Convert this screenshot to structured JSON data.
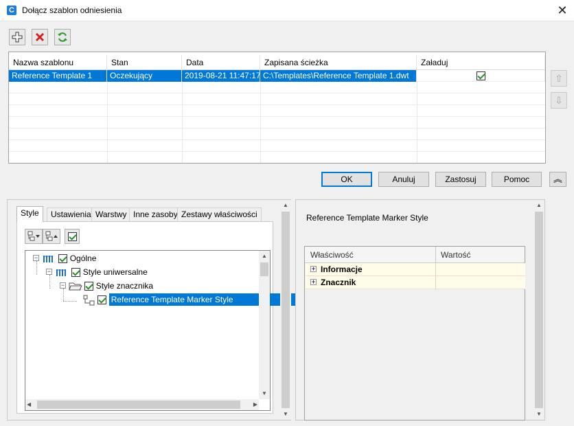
{
  "window": {
    "title": "Dołącz szablon odniesienia",
    "close_label": "✕"
  },
  "toolbar": {
    "add_icon": "plus-icon",
    "delete_icon": "red-x-icon",
    "refresh_icon": "refresh-icon"
  },
  "grid": {
    "columns": [
      "Nazwa szablonu",
      "Stan",
      "Data",
      "Zapisana ścieżka",
      "Załaduj"
    ],
    "rows": [
      {
        "name": "Reference Template 1",
        "state": "Oczekujący",
        "date": "2019-08-21 11:47:17",
        "path": "C:\\Templates\\Reference Template 1.dwt",
        "load": true
      }
    ]
  },
  "side_buttons": {
    "up_label": "⇧",
    "down_label": "⇩"
  },
  "buttons": {
    "ok": "OK",
    "cancel": "Anuluj",
    "apply": "Zastosuj",
    "help": "Pomoc",
    "collapse": "︽"
  },
  "tabs": [
    "Style",
    "Ustawienia",
    "Warstwy",
    "Inne zasoby",
    "Zestawy właściwości"
  ],
  "tree": {
    "n1": "Ogólne",
    "n2": "Style uniwersalne",
    "n3": "Style znacznika",
    "n4": "Reference Template Marker Style"
  },
  "right": {
    "heading": "Reference Template Marker Style",
    "col_property": "Właściwość",
    "col_value": "Wartość",
    "rows": [
      "Informacje",
      "Znacznik"
    ]
  },
  "colors": {
    "selection": "#0078d7",
    "accent": "#1e7bd6",
    "check": "#2a8c2a",
    "delete": "#d42020",
    "refresh": "#2a9a2a"
  }
}
